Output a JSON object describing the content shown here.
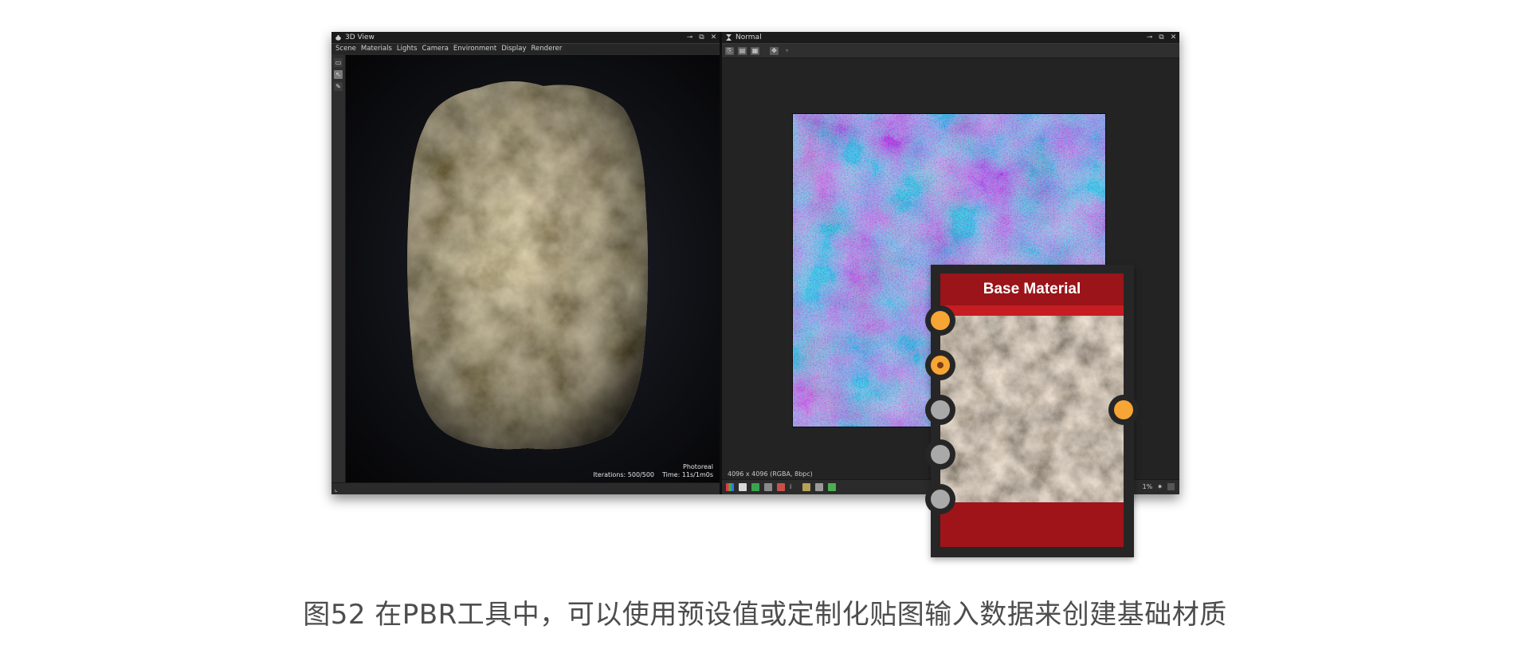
{
  "left_panel": {
    "title": "3D View",
    "menu": [
      "Scene",
      "Materials",
      "Lights",
      "Camera",
      "Environment",
      "Display",
      "Renderer"
    ],
    "render_mode": "Photoreal",
    "iterations": "Iterations: 500/500",
    "time": "Time: 11s/1m0s"
  },
  "right_panel": {
    "title": "Normal",
    "resolution_info": "4096 x 4096 (RGBA, 8bpc)",
    "zoom_partial": "1%"
  },
  "node": {
    "title": "Base Material",
    "accent": "#9a1419",
    "port_color": "#f7a535",
    "inactive_port_color": "#a9a9a9"
  },
  "caption": "图52 在PBR工具中，可以使用预设值或定制化贴图输入数据来创建基础材质"
}
